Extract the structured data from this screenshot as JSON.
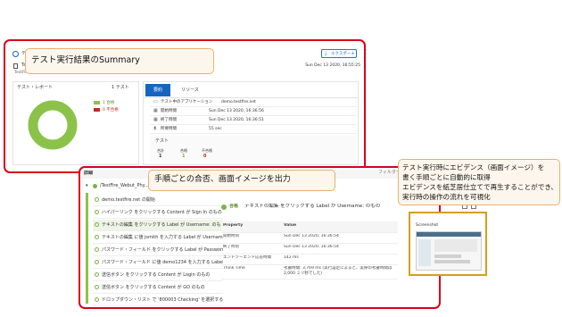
{
  "summary_header": {
    "report_icon": "globe-icon",
    "title_partial": "デ",
    "subtitle_partial": "Ta",
    "path_partial": "TestFire...",
    "export_label": "エクスポート",
    "date": "Sun Dec 13 2020, 16:55:25"
  },
  "callouts": {
    "summary": "テスト実行結果のSummary",
    "steps": "手順ごとの合否、画面イメージを出力",
    "evidence": [
      "テスト実行時にエビデンス（画面イメージ）を",
      "書く手順ごとに自動的に取得",
      "エビデンスを紙芝居仕立てで再生することができ、",
      "実行時の操作の流れを可視化"
    ]
  },
  "test_report": {
    "title": "テスト・レポート",
    "count_label": "1 テスト",
    "legend": [
      {
        "label": "1 合格",
        "color": "#8bc34a"
      },
      {
        "label": "0 不合格",
        "color": "#c62828"
      }
    ],
    "chart_data": {
      "type": "pie",
      "categories": [
        "合格",
        "不合格"
      ],
      "values": [
        1,
        0
      ],
      "colors": [
        "#8bc34a",
        "#c62828"
      ]
    }
  },
  "summary_tabs": {
    "summary_label": "要約",
    "resources_label": "リソース"
  },
  "summary_info": {
    "rows": [
      {
        "icon": "monitor-icon",
        "label": "テスト中のアプリケーション",
        "value": "demo.testfire.net"
      },
      {
        "icon": "calendar-icon",
        "label": "開始時間",
        "value": "Sun Dec 13 2020, 16:36:56"
      },
      {
        "icon": "calendar-icon",
        "label": "終了時間",
        "value": "Sun Dec 13 2020, 16:36:51"
      },
      {
        "icon": "hourglass-icon",
        "label": "所要時間",
        "value": "55 sec"
      }
    ],
    "tests_heading": "テスト",
    "stats": [
      {
        "label": "合計",
        "value": "1",
        "color": "#333333"
      },
      {
        "label": "合格",
        "value": "1",
        "color": "#7cb342"
      },
      {
        "label": "不合格",
        "value": "0",
        "color": "#c62828"
      }
    ]
  },
  "details": {
    "title": "詳細",
    "filter_label": "フィルター",
    "test_path": "/TestFire_Webut_Phy...",
    "steps": [
      "demo.testfire.net の開始",
      "ハイパーリンク をクリックする Content が Sign In のもの",
      "テキストの編集 をクリックする Label が Username: のもの",
      "テキストの編集 に値 jsmith を入力する Label が Username: のもの",
      "パスワード・フィールド をクリックする Label が Password: のもの",
      "パスワード・フィールド に値 demo1234 を入力する Label が Pa...",
      "送信ボタン をクリックする Content が Login のもの",
      "送信ボタン をクリックする Content が GO のもの",
      "ドロップダウン・リスト で '800003 Checking' を選択する Label..."
    ],
    "step_status": "合格",
    "step_title": "テキストの編集 をクリックする Label が Username: のもの",
    "table_headers": [
      "Property",
      "Value"
    ],
    "table_rows": [
      [
        "開始時刻",
        "Sun Dec 13 2020, 16:36:54"
      ],
      [
        "終了時刻",
        "Sun Dec 13 2020, 16:36:54"
      ],
      [
        "エンドツーエンド応答時間",
        "142 ms"
      ],
      [
        "Think Time",
        "考慮時間: 3,769 ms (実行設定によると、実際の考慮時間は 2,000 ミリ秒でした)"
      ]
    ],
    "screenshot_label": "Screenshot"
  }
}
